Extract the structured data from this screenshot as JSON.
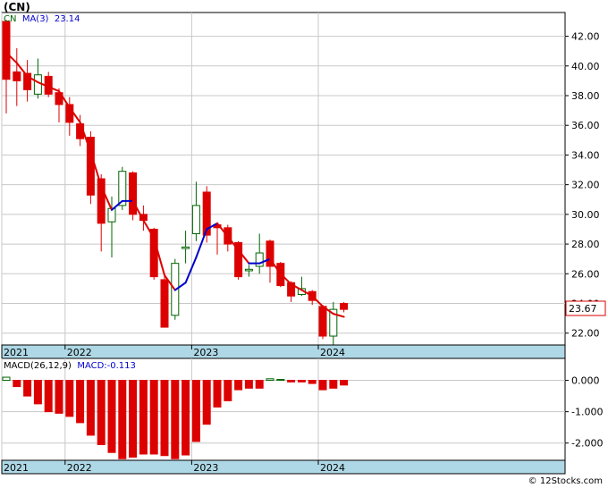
{
  "header": {
    "ticker": "(CN)",
    "legend": [
      {
        "label": "CN",
        "color": "#006400"
      },
      {
        "label": "MA(3)",
        "color": "#0000cc"
      },
      {
        "label": "23.14",
        "color": "#0000cc"
      }
    ]
  },
  "macd_header": {
    "legend": [
      {
        "label": "MACD(26,12,9)",
        "color": "#000000"
      },
      {
        "label": "MACD:-0.113",
        "color": "#0000cc"
      }
    ]
  },
  "watermark": "© 12Stocks.com",
  "colors": {
    "up": "#006400",
    "down": "#dd0000",
    "ma_up": "#0000cc",
    "ma_down": "#dd0000",
    "grid": "#c8c8c8",
    "axis_band": "#aed8e6",
    "price_box_border": "#dd0000"
  },
  "chart_data": [
    {
      "type": "candlestick",
      "title": "(CN)",
      "xlabel": "",
      "ylabel": "",
      "x_tick_labels": [
        "2021",
        "2022",
        "2023",
        "2024"
      ],
      "ylim": [
        21.2,
        43.6
      ],
      "y_ticks": [
        22.0,
        24.0,
        26.0,
        28.0,
        30.0,
        32.0,
        34.0,
        36.0,
        38.0,
        40.0,
        42.0
      ],
      "y_tick_labels": [
        "22.00",
        "24.00",
        "26.00",
        "28.00",
        "30.00",
        "32.00",
        "34.00",
        "36.00",
        "38.00",
        "40.00",
        "42.00"
      ],
      "last_price_label": "23.67",
      "grid": true,
      "candles": [
        {
          "o": 43.0,
          "h": 43.1,
          "l": 36.8,
          "c": 39.1
        },
        {
          "o": 39.6,
          "h": 41.2,
          "l": 37.3,
          "c": 39.0
        },
        {
          "o": 39.5,
          "h": 40.4,
          "l": 37.6,
          "c": 38.4
        },
        {
          "o": 38.1,
          "h": 40.5,
          "l": 37.8,
          "c": 39.4
        },
        {
          "o": 39.3,
          "h": 39.6,
          "l": 37.9,
          "c": 38.1
        },
        {
          "o": 38.2,
          "h": 38.5,
          "l": 36.2,
          "c": 37.4
        },
        {
          "o": 37.4,
          "h": 37.9,
          "l": 35.3,
          "c": 36.2
        },
        {
          "o": 36.1,
          "h": 36.7,
          "l": 34.6,
          "c": 35.1
        },
        {
          "o": 35.2,
          "h": 35.6,
          "l": 30.7,
          "c": 31.3
        },
        {
          "o": 32.4,
          "h": 32.7,
          "l": 27.5,
          "c": 29.4
        },
        {
          "o": 29.5,
          "h": 31.2,
          "l": 27.1,
          "c": 30.4
        },
        {
          "o": 30.6,
          "h": 33.2,
          "l": 30.3,
          "c": 32.9
        },
        {
          "o": 32.8,
          "h": 32.9,
          "l": 29.6,
          "c": 30.0
        },
        {
          "o": 30.0,
          "h": 30.6,
          "l": 28.9,
          "c": 29.6
        },
        {
          "o": 29.0,
          "h": 29.1,
          "l": 25.6,
          "c": 25.8
        },
        {
          "o": 25.6,
          "h": 25.9,
          "l": 22.4,
          "c": 22.4
        },
        {
          "o": 23.2,
          "h": 27.0,
          "l": 22.9,
          "c": 26.7
        },
        {
          "o": 27.7,
          "h": 28.9,
          "l": 26.7,
          "c": 27.8
        },
        {
          "o": 28.7,
          "h": 32.2,
          "l": 28.2,
          "c": 30.6
        },
        {
          "o": 31.5,
          "h": 31.9,
          "l": 28.1,
          "c": 28.6
        },
        {
          "o": 29.3,
          "h": 29.4,
          "l": 27.3,
          "c": 29.1
        },
        {
          "o": 29.1,
          "h": 29.3,
          "l": 27.5,
          "c": 28.0
        },
        {
          "o": 28.1,
          "h": 28.2,
          "l": 25.6,
          "c": 25.8
        },
        {
          "o": 26.2,
          "h": 26.6,
          "l": 25.8,
          "c": 26.3
        },
        {
          "o": 26.5,
          "h": 28.7,
          "l": 26.0,
          "c": 27.4
        },
        {
          "o": 28.2,
          "h": 28.3,
          "l": 25.4,
          "c": 26.5
        },
        {
          "o": 26.7,
          "h": 26.8,
          "l": 25.1,
          "c": 25.2
        },
        {
          "o": 25.4,
          "h": 25.5,
          "l": 24.1,
          "c": 24.5
        },
        {
          "o": 24.6,
          "h": 25.8,
          "l": 24.5,
          "c": 25.0
        },
        {
          "o": 24.8,
          "h": 24.9,
          "l": 23.9,
          "c": 24.2
        },
        {
          "o": 23.8,
          "h": 23.9,
          "l": 21.6,
          "c": 21.8
        },
        {
          "o": 21.8,
          "h": 24.1,
          "l": 21.2,
          "c": 23.6
        },
        {
          "o": 24.0,
          "h": 24.1,
          "l": 23.4,
          "c": 23.6
        }
      ],
      "ma": [
        40.9,
        40.2,
        39.3,
        38.9,
        38.6,
        38.3,
        37.2,
        36.2,
        34.2,
        31.9,
        30.3,
        30.9,
        30.9,
        29.6,
        28.4,
        25.9,
        24.9,
        25.4,
        27.1,
        29.0,
        29.4,
        28.5,
        27.6,
        26.7,
        26.7,
        27.0,
        26.0,
        25.3,
        24.9,
        24.5,
        23.8,
        23.3,
        23.1
      ],
      "ma_color": [
        "red",
        "red",
        "red",
        "red",
        "red",
        "red",
        "red",
        "red",
        "red",
        "red",
        "red",
        "blue",
        "blue",
        "red",
        "red",
        "red",
        "red",
        "blue",
        "blue",
        "blue",
        "blue",
        "red",
        "red",
        "red",
        "blue",
        "blue",
        "red",
        "red",
        "red",
        "red",
        "red",
        "red",
        "red"
      ]
    },
    {
      "type": "bar",
      "title": "MACD(26,12,9)",
      "xlabel": "",
      "ylabel": "",
      "x_tick_labels": [
        "2021",
        "2022",
        "2023",
        "2024"
      ],
      "ylim": [
        -2.55,
        0.7
      ],
      "y_ticks": [
        0.0,
        -1.0,
        -2.0
      ],
      "y_tick_labels": [
        "0.000",
        "-1.000",
        "-2.000"
      ],
      "grid": true,
      "series": [
        {
          "values": [
            0.1,
            -0.2,
            -0.5,
            -0.75,
            -1.0,
            -1.05,
            -1.15,
            -1.35,
            -1.75,
            -2.05,
            -2.3,
            -2.5,
            -2.45,
            -2.35,
            -2.35,
            -2.4,
            -2.5,
            -2.38,
            -1.95,
            -1.4,
            -0.85,
            -0.65,
            -0.3,
            -0.25,
            -0.25,
            0.05,
            0.03,
            -0.05,
            -0.05,
            -0.1,
            -0.3,
            -0.25,
            -0.15
          ]
        }
      ]
    }
  ]
}
